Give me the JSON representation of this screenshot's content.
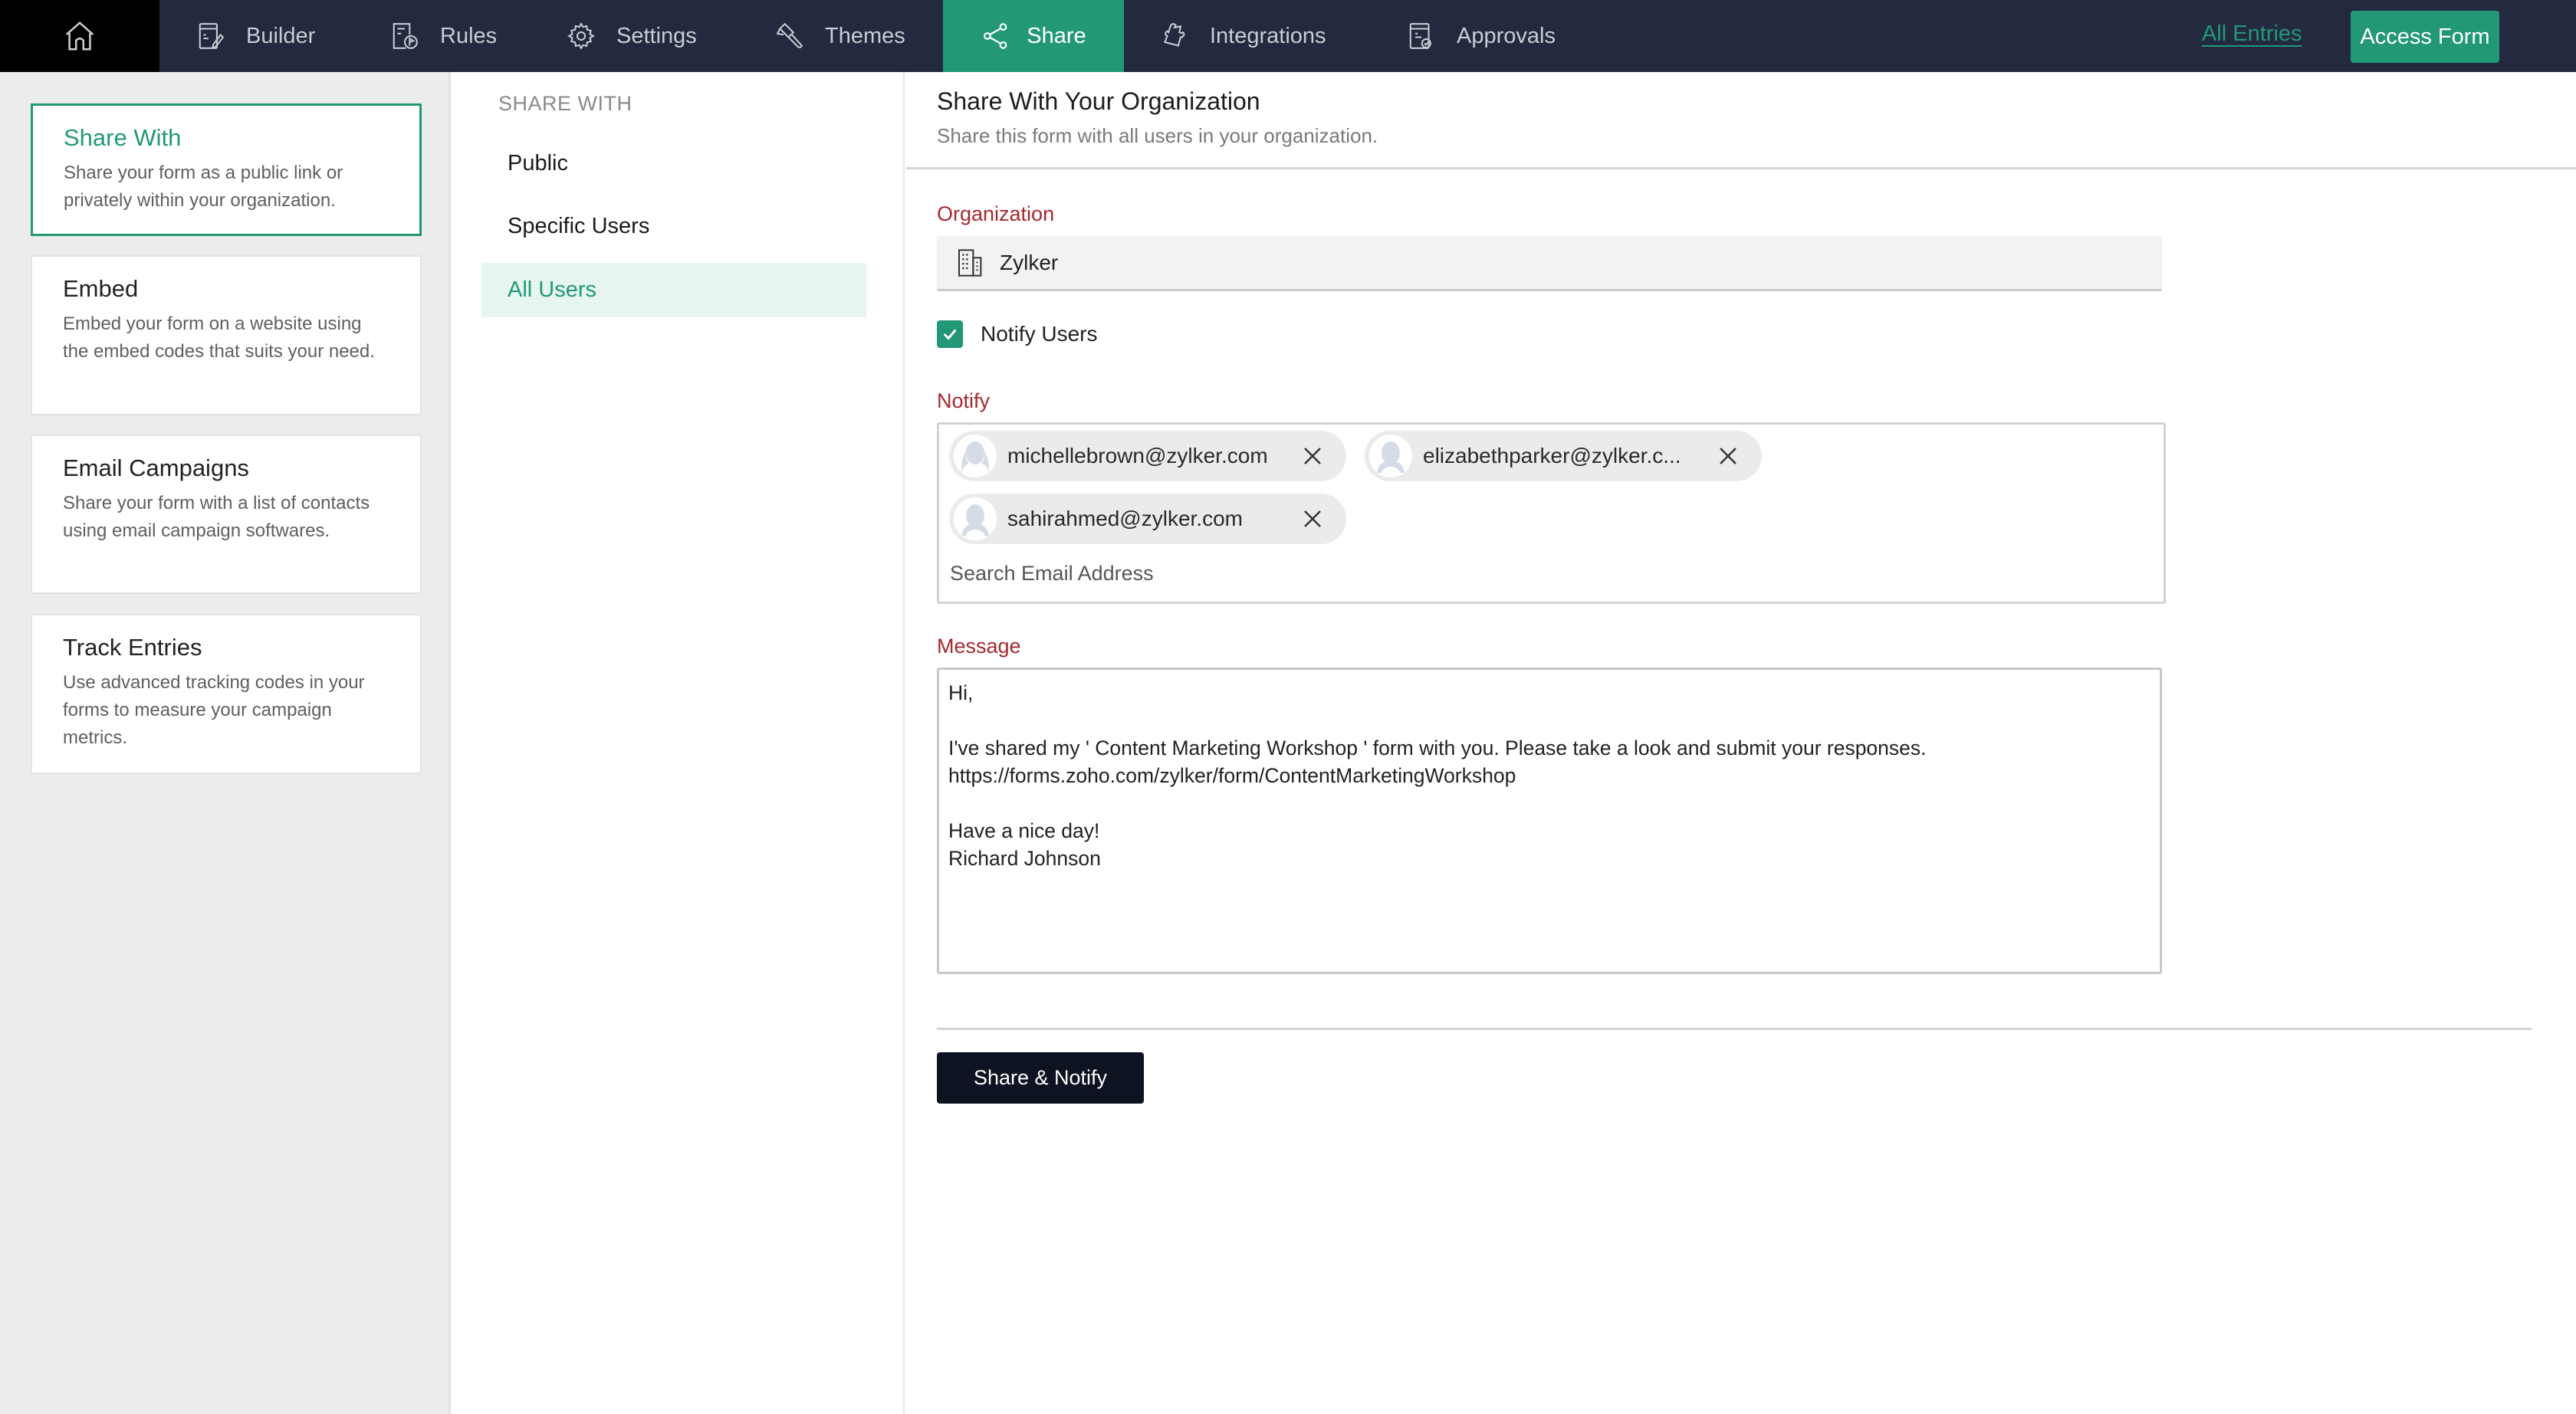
{
  "topnav": {
    "home_icon": "home-icon",
    "items": [
      {
        "label": "Builder",
        "icon": "builder-icon"
      },
      {
        "label": "Rules",
        "icon": "rules-icon"
      },
      {
        "label": "Settings",
        "icon": "gear-icon"
      },
      {
        "label": "Themes",
        "icon": "paint-brush-icon"
      },
      {
        "label": "Share",
        "icon": "share-icon",
        "active": true
      },
      {
        "label": "Integrations",
        "icon": "puzzle-icon"
      },
      {
        "label": "Approvals",
        "icon": "approvals-icon"
      }
    ],
    "all_entries_label": "All Entries",
    "access_form_label": "Access Form"
  },
  "sidebar": {
    "cards": [
      {
        "title": "Share With",
        "description": "Share your form as a public link or privately within your organization.",
        "active": true
      },
      {
        "title": "Embed",
        "description": "Embed your form on a website using the embed codes that suits your need."
      },
      {
        "title": "Email Campaigns",
        "description": "Share your form with a list of contacts using email campaign softwares."
      },
      {
        "title": "Track Entries",
        "description": "Use advanced tracking codes in your forms to measure your campaign metrics."
      }
    ]
  },
  "share_with": {
    "heading": "SHARE WITH",
    "options": [
      {
        "label": "Public"
      },
      {
        "label": "Specific Users"
      },
      {
        "label": "All Users",
        "active": true
      }
    ]
  },
  "main": {
    "title": "Share With Your Organization",
    "subtitle": "Share this form with all users in your organization.",
    "organization_label": "Organization",
    "organization_value": "Zylker",
    "notify_users_label": "Notify Users",
    "notify_users_checked": true,
    "notify_label": "Notify",
    "recipients": [
      "michellebrown@zylker.com",
      "elizabethparker@zylker.c...",
      "sahirahmed@zylker.com"
    ],
    "search_placeholder": "Search Email Address",
    "message_label": "Message",
    "message_text": "Hi,\n\nI've shared my ' Content Marketing Workshop ' form with you. Please take a look and submit your responses.\nhttps://forms.zoho.com/zylker/form/ContentMarketingWorkshop\n\nHave a nice day!\nRichard Johnson",
    "share_notify_label": "Share & Notify"
  },
  "colors": {
    "accent": "#229877",
    "nav_bg": "#232a40",
    "label_red": "#a6282e",
    "button_dark": "#0d1320"
  }
}
